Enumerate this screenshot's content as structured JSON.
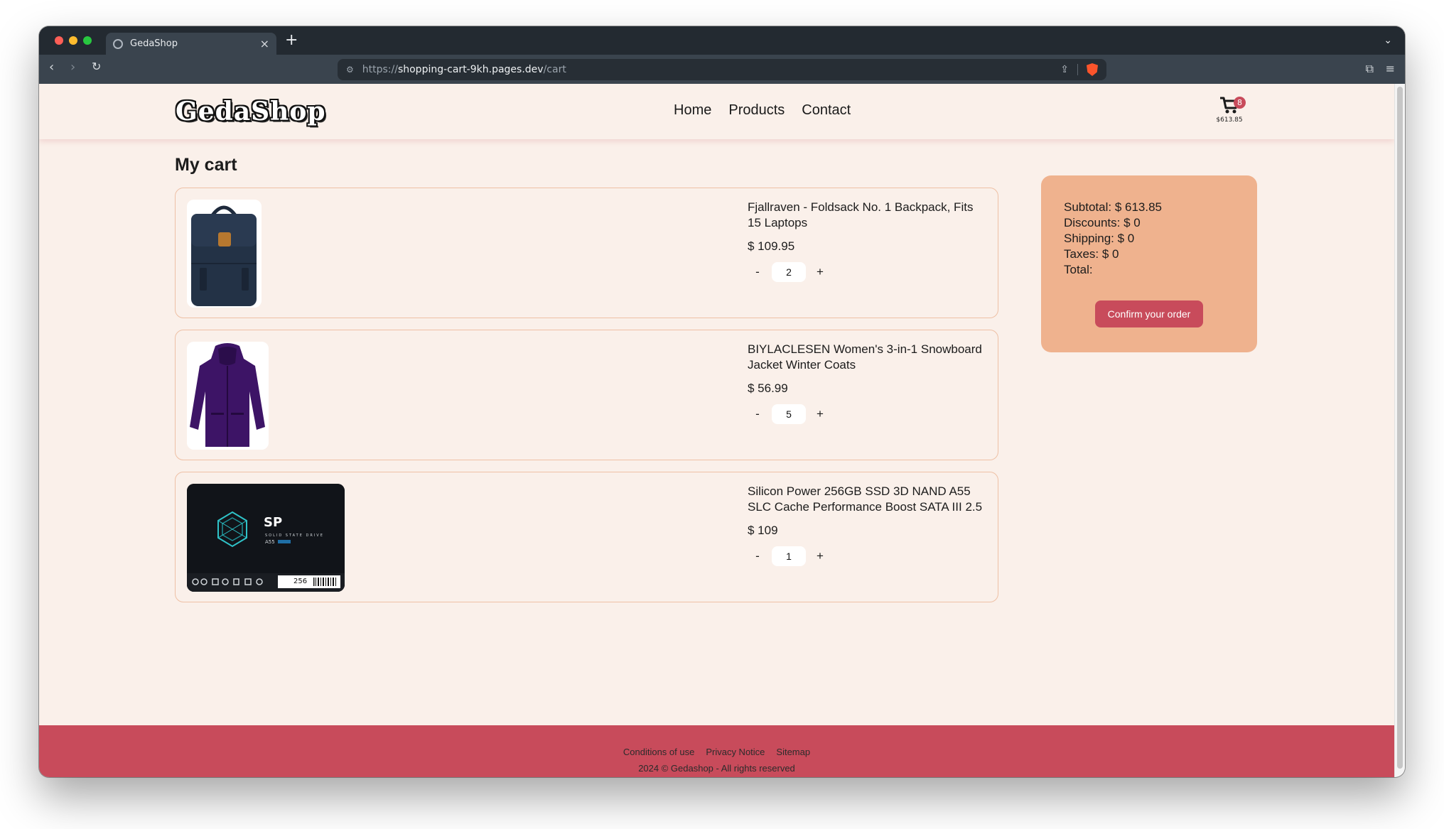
{
  "browser": {
    "tab_title": "GedaShop",
    "url_scheme": "https://",
    "url_host": "shopping-cart-9kh.pages.dev",
    "url_path": "/cart"
  },
  "site": {
    "logo": "GedaShop",
    "nav": [
      "Home",
      "Products",
      "Contact"
    ],
    "cart_count": "8",
    "cart_total": "$613.85"
  },
  "page_title": "My cart",
  "cart_items": [
    {
      "name": "Fjallraven - Foldsack No. 1 Backpack, Fits 15 Laptops",
      "price": "$ 109.95",
      "quantity": "2"
    },
    {
      "name": "BIYLACLESEN Women's 3-in-1 Snowboard Jacket Winter Coats",
      "price": "$ 56.99",
      "quantity": "5"
    },
    {
      "name": "Silicon Power 256GB SSD 3D NAND A55 SLC Cache Performance Boost SATA III 2.5",
      "price": "$ 109",
      "quantity": "1"
    }
  ],
  "qty_controls": {
    "minus": "-",
    "plus": "+"
  },
  "ssd_label": {
    "brand": "SP",
    "line": "SOLID STATE DRIVE",
    "model": "A55",
    "capacity": "256"
  },
  "summary": {
    "subtotal": "Subtotal: $ 613.85",
    "discounts": "Discounts: $ 0",
    "shipping": "Shipping: $ 0",
    "taxes": "Taxes: $ 0",
    "total": "Total:",
    "confirm_label": "Confirm your order"
  },
  "footer": {
    "links": [
      "Conditions of use",
      "Privacy Notice",
      "Sitemap"
    ],
    "copyright": "2024 © Gedashop - All rights reserved"
  },
  "colors": {
    "page_bg": "#faf0ea",
    "accent": "#c84b5b",
    "summary_bg": "#efb28e",
    "card_border": "#eec0a5"
  }
}
